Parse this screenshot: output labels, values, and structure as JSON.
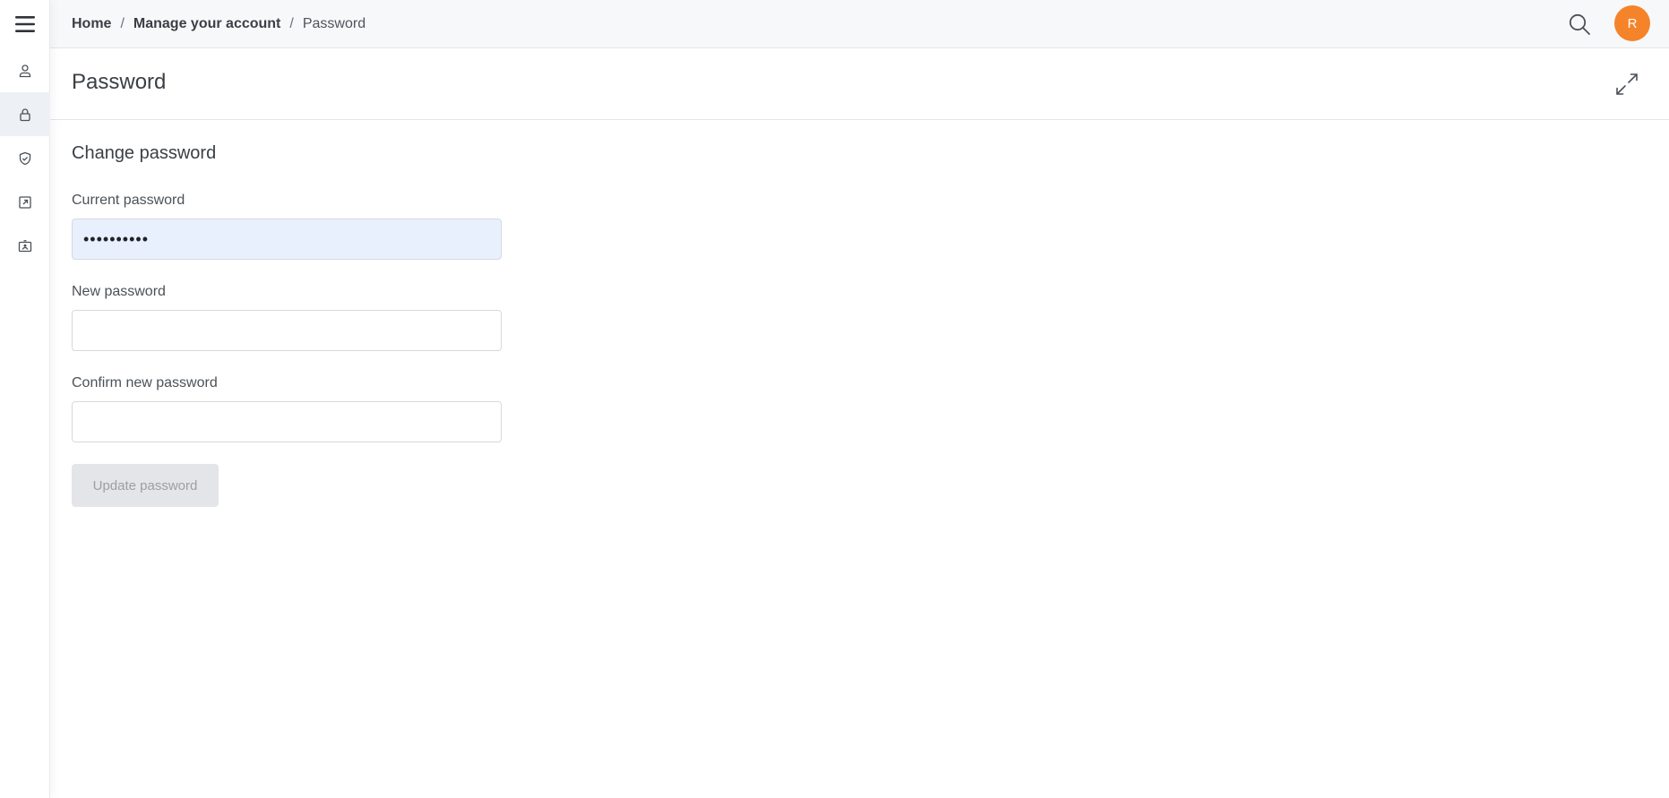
{
  "breadcrumb": {
    "home": "Home",
    "separator_1": "/",
    "account": "Manage your account",
    "separator_2": "/",
    "current": "Password"
  },
  "header": {
    "search_icon": "search-icon",
    "avatar_initial": "R",
    "avatar_color": "#f5832a"
  },
  "sidebar": {
    "menu_icon": "hamburger-menu-icon",
    "items": [
      {
        "icon": "user-icon",
        "active": false
      },
      {
        "icon": "lock-icon",
        "active": true
      },
      {
        "icon": "shield-check-icon",
        "active": false
      },
      {
        "icon": "external-link-icon",
        "active": false
      },
      {
        "icon": "id-card-icon",
        "active": false
      }
    ]
  },
  "page": {
    "title": "Password",
    "expand_icon": "expand-icon"
  },
  "form": {
    "section_title": "Change password",
    "current_password": {
      "label": "Current password",
      "value": "••••••••••"
    },
    "new_password": {
      "label": "New password",
      "value": ""
    },
    "confirm_password": {
      "label": "Confirm new password",
      "value": ""
    },
    "submit_label": "Update password",
    "submit_disabled": true
  }
}
